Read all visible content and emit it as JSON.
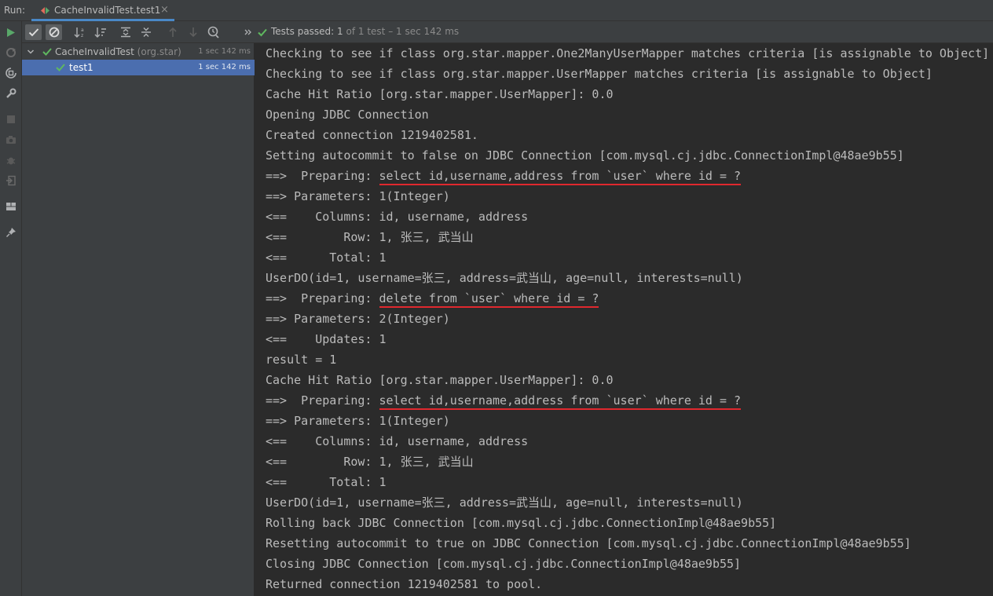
{
  "run_label": "Run:",
  "run_tab": {
    "title": "CacheInvalidTest.test1",
    "close": "×"
  },
  "status": {
    "prefix": "Tests passed:",
    "count": "1",
    "suffix": "of 1 test – 1 sec 142 ms"
  },
  "tree": {
    "suite": {
      "name": "CacheInvalidTest",
      "package": "(org.star)",
      "time": "1 sec 142 ms"
    },
    "test": {
      "name": "test1",
      "time": "1 sec 142 ms"
    }
  },
  "console_lines": [
    {
      "text": "Checking to see if class org.star.mapper.One2ManyUserMapper matches criteria [is assignable to Object]"
    },
    {
      "text": "Checking to see if class org.star.mapper.UserMapper matches criteria [is assignable to Object]"
    },
    {
      "text": "Cache Hit Ratio [org.star.mapper.UserMapper]: 0.0"
    },
    {
      "text": "Opening JDBC Connection"
    },
    {
      "text": "Created connection 1219402581."
    },
    {
      "text": "Setting autocommit to false on JDBC Connection [com.mysql.cj.jdbc.ConnectionImpl@48ae9b55]"
    },
    {
      "prefix": "==>  Preparing: ",
      "sql": "select id,username,address from `user` where id = ?"
    },
    {
      "text": "==> Parameters: 1(Integer)"
    },
    {
      "text": "<==    Columns: id, username, address"
    },
    {
      "text": "<==        Row: 1, 张三, 武当山"
    },
    {
      "text": "<==      Total: 1"
    },
    {
      "text": "UserDO(id=1, username=张三, address=武当山, age=null, interests=null)"
    },
    {
      "prefix": "==>  Preparing: ",
      "sql": "delete from `user` where id = ?"
    },
    {
      "text": "==> Parameters: 2(Integer)"
    },
    {
      "text": "<==    Updates: 1"
    },
    {
      "text": "result = 1"
    },
    {
      "text": "Cache Hit Ratio [org.star.mapper.UserMapper]: 0.0"
    },
    {
      "prefix": "==>  Preparing: ",
      "sql": "select id,username,address from `user` where id = ?"
    },
    {
      "text": "==> Parameters: 1(Integer)"
    },
    {
      "text": "<==    Columns: id, username, address"
    },
    {
      "text": "<==        Row: 1, 张三, 武当山"
    },
    {
      "text": "<==      Total: 1"
    },
    {
      "text": "UserDO(id=1, username=张三, address=武当山, age=null, interests=null)"
    },
    {
      "text": "Rolling back JDBC Connection [com.mysql.cj.jdbc.ConnectionImpl@48ae9b55]"
    },
    {
      "text": "Resetting autocommit to true on JDBC Connection [com.mysql.cj.jdbc.ConnectionImpl@48ae9b55]"
    },
    {
      "text": "Closing JDBC Connection [com.mysql.cj.jdbc.ConnectionImpl@48ae9b55]"
    },
    {
      "text": "Returned connection 1219402581 to pool."
    }
  ],
  "colors": {
    "pass_green": "#5fb85f",
    "highlight_red": "#e0282e",
    "selection": "#4b6eaf",
    "run_green": "#59a869"
  },
  "icons": {
    "left_toolbar": [
      "rerun-icon",
      "rerun-failed-icon",
      "toggle-auto-test-icon",
      "settings-wrench-icon",
      "stop-icon",
      "camera-icon",
      "debug-bug-icon",
      "exit-icon",
      "layout-icon",
      "pin-icon"
    ],
    "test_toolbar": [
      "show-passed-icon",
      "show-ignored-icon",
      "sort-alpha-icon",
      "sort-duration-icon",
      "expand-all-icon",
      "collapse-all-icon",
      "previous-failed-icon",
      "next-failed-icon",
      "history-icon",
      "more-icon"
    ]
  }
}
